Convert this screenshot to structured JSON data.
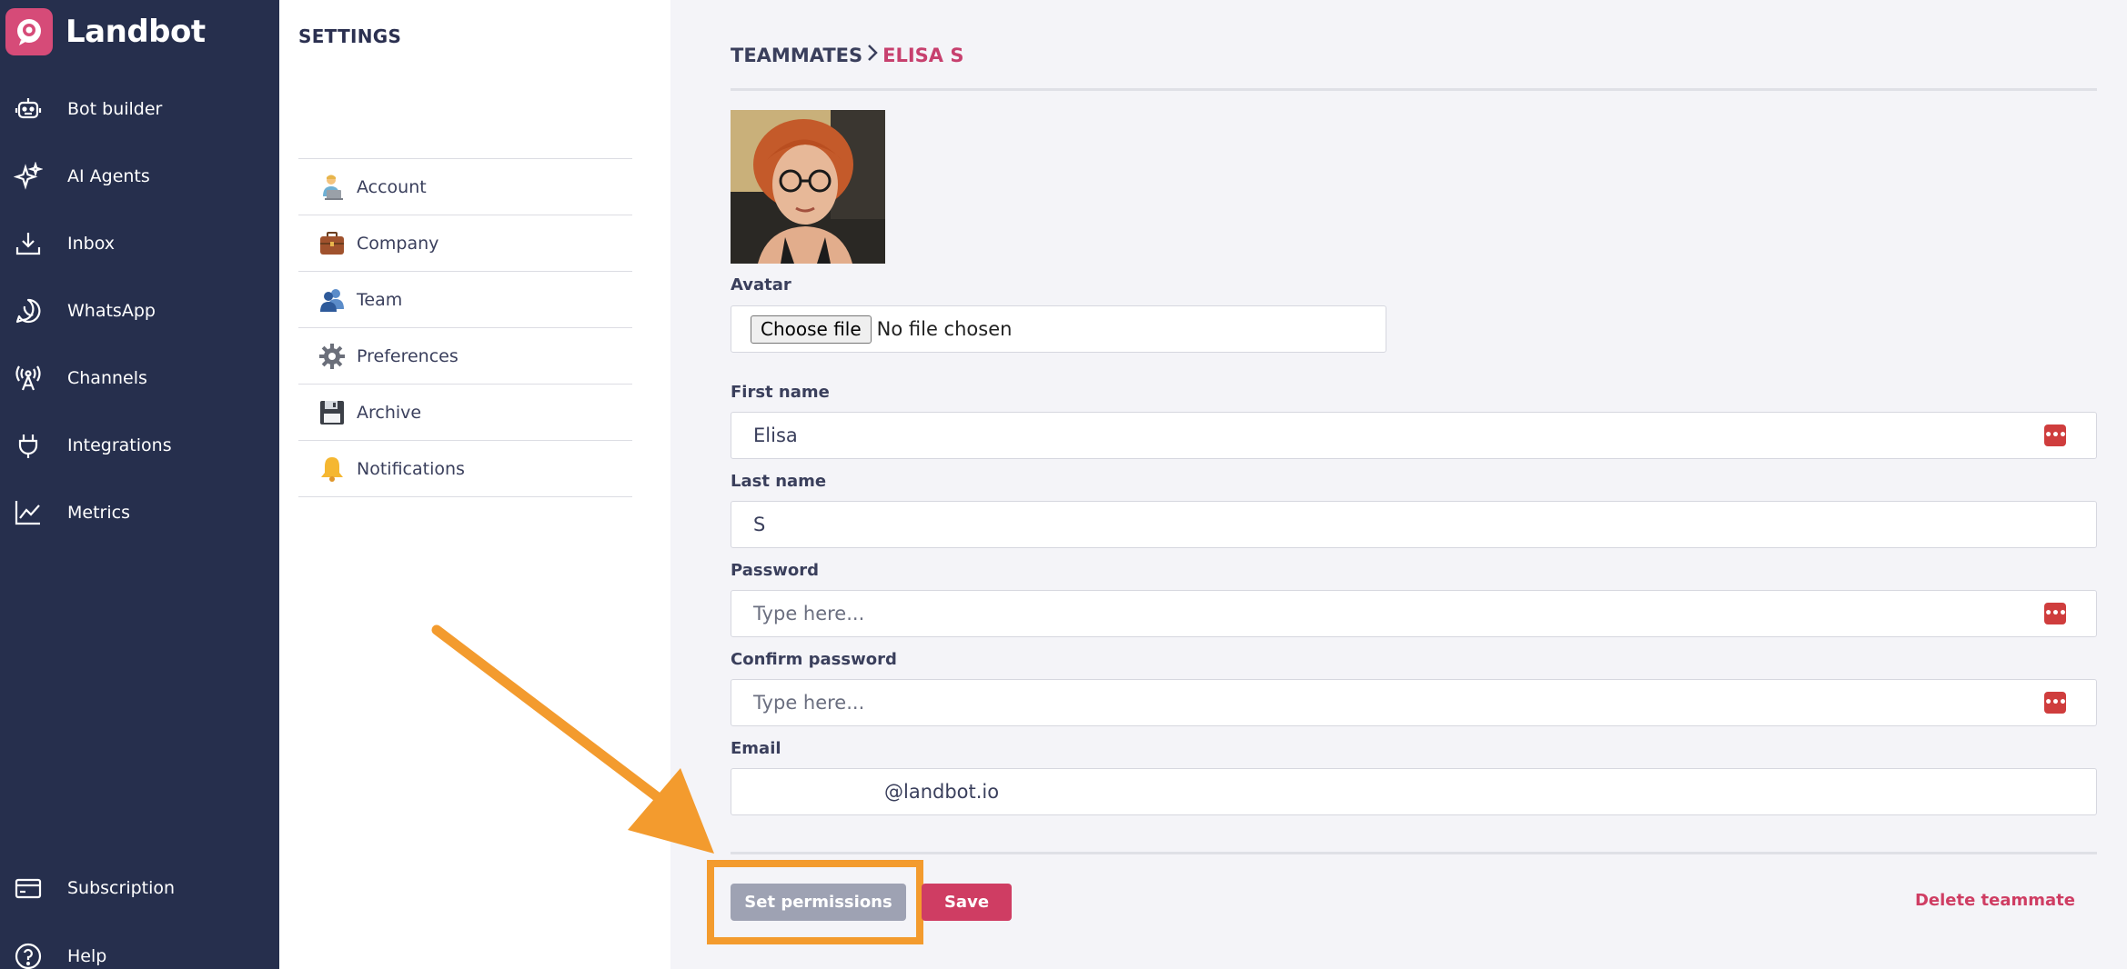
{
  "brand": {
    "name": "Landbot",
    "accent": "#d64b78"
  },
  "nav": {
    "items": [
      {
        "label": "Bot builder",
        "icon": "robot-icon"
      },
      {
        "label": "AI Agents",
        "icon": "sparkles-icon"
      },
      {
        "label": "Inbox",
        "icon": "inbox-download-icon"
      },
      {
        "label": "WhatsApp",
        "icon": "whatsapp-icon"
      },
      {
        "label": "Channels",
        "icon": "broadcast-tower-icon"
      },
      {
        "label": "Integrations",
        "icon": "plug-icon"
      },
      {
        "label": "Metrics",
        "icon": "line-chart-icon"
      }
    ],
    "bottom_items": [
      {
        "label": "Subscription",
        "icon": "card-icon"
      },
      {
        "label": "Help",
        "icon": "question-icon"
      }
    ]
  },
  "settings": {
    "title": "SETTINGS",
    "menu": [
      {
        "label": "Account",
        "icon": "person-laptop-icon"
      },
      {
        "label": "Company",
        "icon": "briefcase-icon"
      },
      {
        "label": "Team",
        "icon": "people-icon"
      },
      {
        "label": "Preferences",
        "icon": "gear-icon"
      },
      {
        "label": "Archive",
        "icon": "floppy-disk-icon"
      },
      {
        "label": "Notifications",
        "icon": "bell-icon"
      }
    ]
  },
  "main": {
    "breadcrumb": {
      "parent": "TEAMMATES",
      "separator": ">",
      "current": "ELISA S"
    },
    "avatar": {
      "label": "Avatar",
      "button": "Choose file",
      "status": "No file chosen"
    },
    "first_name": {
      "label": "First name",
      "value": "Elisa"
    },
    "last_name": {
      "label": "Last name",
      "value": "S"
    },
    "password": {
      "label": "Password",
      "placeholder": "Type here..."
    },
    "confirm_password": {
      "label": "Confirm password",
      "placeholder": "Type here..."
    },
    "email": {
      "label": "Email",
      "domain": "@landbot.io"
    },
    "actions": {
      "permissions": "Set permissions",
      "save": "Save",
      "delete": "Delete teammate"
    }
  },
  "colors": {
    "nav_bg": "#262f4d",
    "danger": "#cf3d63",
    "highlight": "#f39b2e"
  }
}
